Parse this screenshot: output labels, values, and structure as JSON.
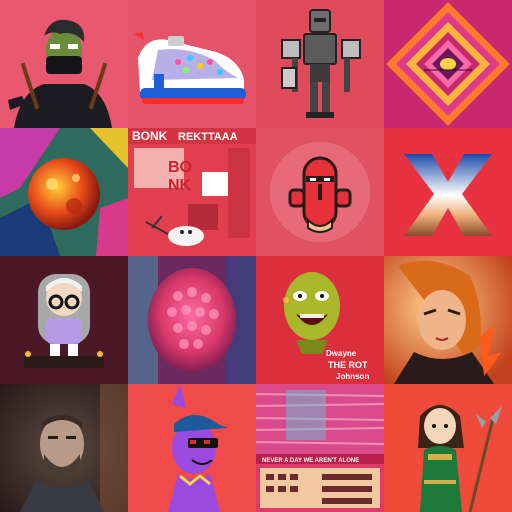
{
  "gallery": {
    "tiles": [
      {
        "id": "ninja-character",
        "bg": "#e8586e"
      },
      {
        "id": "sneaker",
        "bg": "#e6546a"
      },
      {
        "id": "robot",
        "bg": "#df4b5b"
      },
      {
        "id": "geometric-diamond",
        "bg": "#c8266e"
      },
      {
        "id": "planet",
        "bg": "#2e6a5e"
      },
      {
        "id": "bonk-collage",
        "bg": "#e2404f",
        "texts": {
          "title_left": "BONK",
          "title_right": "REKTTAAA",
          "big": "BO",
          "big2": "NK"
        }
      },
      {
        "id": "totem-mascot",
        "bg": "#e05262"
      },
      {
        "id": "x-logo",
        "bg": "#e8323f"
      },
      {
        "id": "nerd-figure",
        "bg": "#4a1826"
      },
      {
        "id": "abstract-blob",
        "bg": "#6a2a5e"
      },
      {
        "id": "zombie-head",
        "bg": "#dc2f3d",
        "texts": {
          "line1": "Dwayne",
          "line2": "THE ROT",
          "line3": "Johnson"
        }
      },
      {
        "id": "anime-girl",
        "bg": "#ee7a2a"
      },
      {
        "id": "portrait-man",
        "bg": "#3a2a28"
      },
      {
        "id": "purple-creature",
        "bg": "#f04a4a"
      },
      {
        "id": "glitch-collage",
        "bg": "#e03a6a",
        "texts": {
          "banner": "NEVER A DAY WE AREN'T ALONE"
        }
      },
      {
        "id": "warrior-chibi",
        "bg": "#f04a3a"
      }
    ]
  }
}
